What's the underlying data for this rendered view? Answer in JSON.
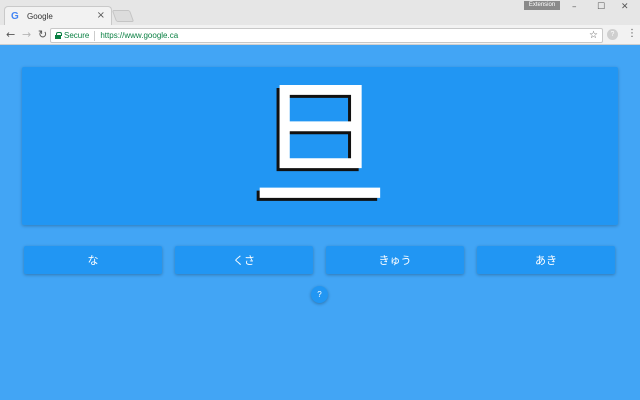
{
  "browser": {
    "tab_title": "Google",
    "tab_favicon": "G",
    "tab_close": "×",
    "extension_badge": "Extension",
    "window_controls": {
      "minimize": "–",
      "maximize": "☐",
      "close": "✕"
    },
    "nav": {
      "back": "←",
      "forward": "→",
      "reload": "↻"
    },
    "secure_label": "Secure",
    "url": "https://www.google.ca",
    "star": "☆",
    "extension_icon_glyph": "?",
    "menu": "⋮"
  },
  "quiz": {
    "kanji": "旦",
    "answers": [
      {
        "label": "な"
      },
      {
        "label": "くさ"
      },
      {
        "label": "きゅう"
      },
      {
        "label": "あき"
      }
    ],
    "help_label": "?"
  },
  "colors": {
    "page_background": "#42a5f5",
    "card_background": "#2196f3",
    "secure_green": "#0b8043"
  },
  "icons": {
    "lock": "lock-icon",
    "star": "star-icon",
    "menu": "menu-icon",
    "help": "help-icon"
  }
}
